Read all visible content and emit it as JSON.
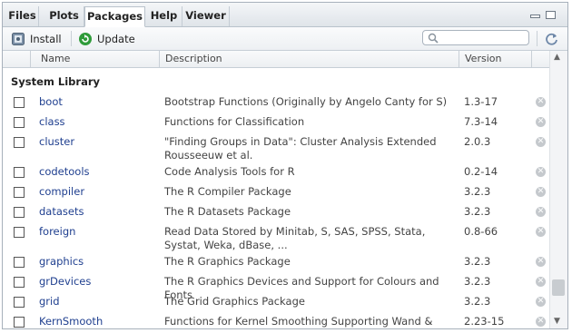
{
  "tabs": [
    {
      "label": "Files",
      "active": false
    },
    {
      "label": "Plots",
      "active": false
    },
    {
      "label": "Packages",
      "active": true
    },
    {
      "label": "Help",
      "active": false
    },
    {
      "label": "Viewer",
      "active": false
    }
  ],
  "toolbar": {
    "install_label": "Install",
    "update_label": "Update",
    "search_placeholder": ""
  },
  "columns": {
    "name": "Name",
    "description": "Description",
    "version": "Version"
  },
  "section_title": "System Library",
  "packages": [
    {
      "name": "boot",
      "description": "Bootstrap Functions (Originally by Angelo Canty for S)",
      "version": "1.3-17"
    },
    {
      "name": "class",
      "description": "Functions for Classification",
      "version": "7.3-14"
    },
    {
      "name": "cluster",
      "description": "\"Finding Groups in Data\": Cluster Analysis Extended Rousseeuw et al.",
      "version": "2.0.3"
    },
    {
      "name": "codetools",
      "description": "Code Analysis Tools for R",
      "version": "0.2-14"
    },
    {
      "name": "compiler",
      "description": "The R Compiler Package",
      "version": "3.2.3"
    },
    {
      "name": "datasets",
      "description": "The R Datasets Package",
      "version": "3.2.3"
    },
    {
      "name": "foreign",
      "description": "Read Data Stored by Minitab, S, SAS, SPSS, Stata, Systat, Weka, dBase, ...",
      "version": "0.8-66"
    },
    {
      "name": "graphics",
      "description": "The R Graphics Package",
      "version": "3.2.3"
    },
    {
      "name": "grDevices",
      "description": "The R Graphics Devices and Support for Colours and Fonts",
      "version": "3.2.3"
    },
    {
      "name": "grid",
      "description": "The Grid Graphics Package",
      "version": "3.2.3"
    },
    {
      "name": "KernSmooth",
      "description": "Functions for Kernel Smoothing Supporting Wand & Jones",
      "version": "2.23-15"
    }
  ]
}
